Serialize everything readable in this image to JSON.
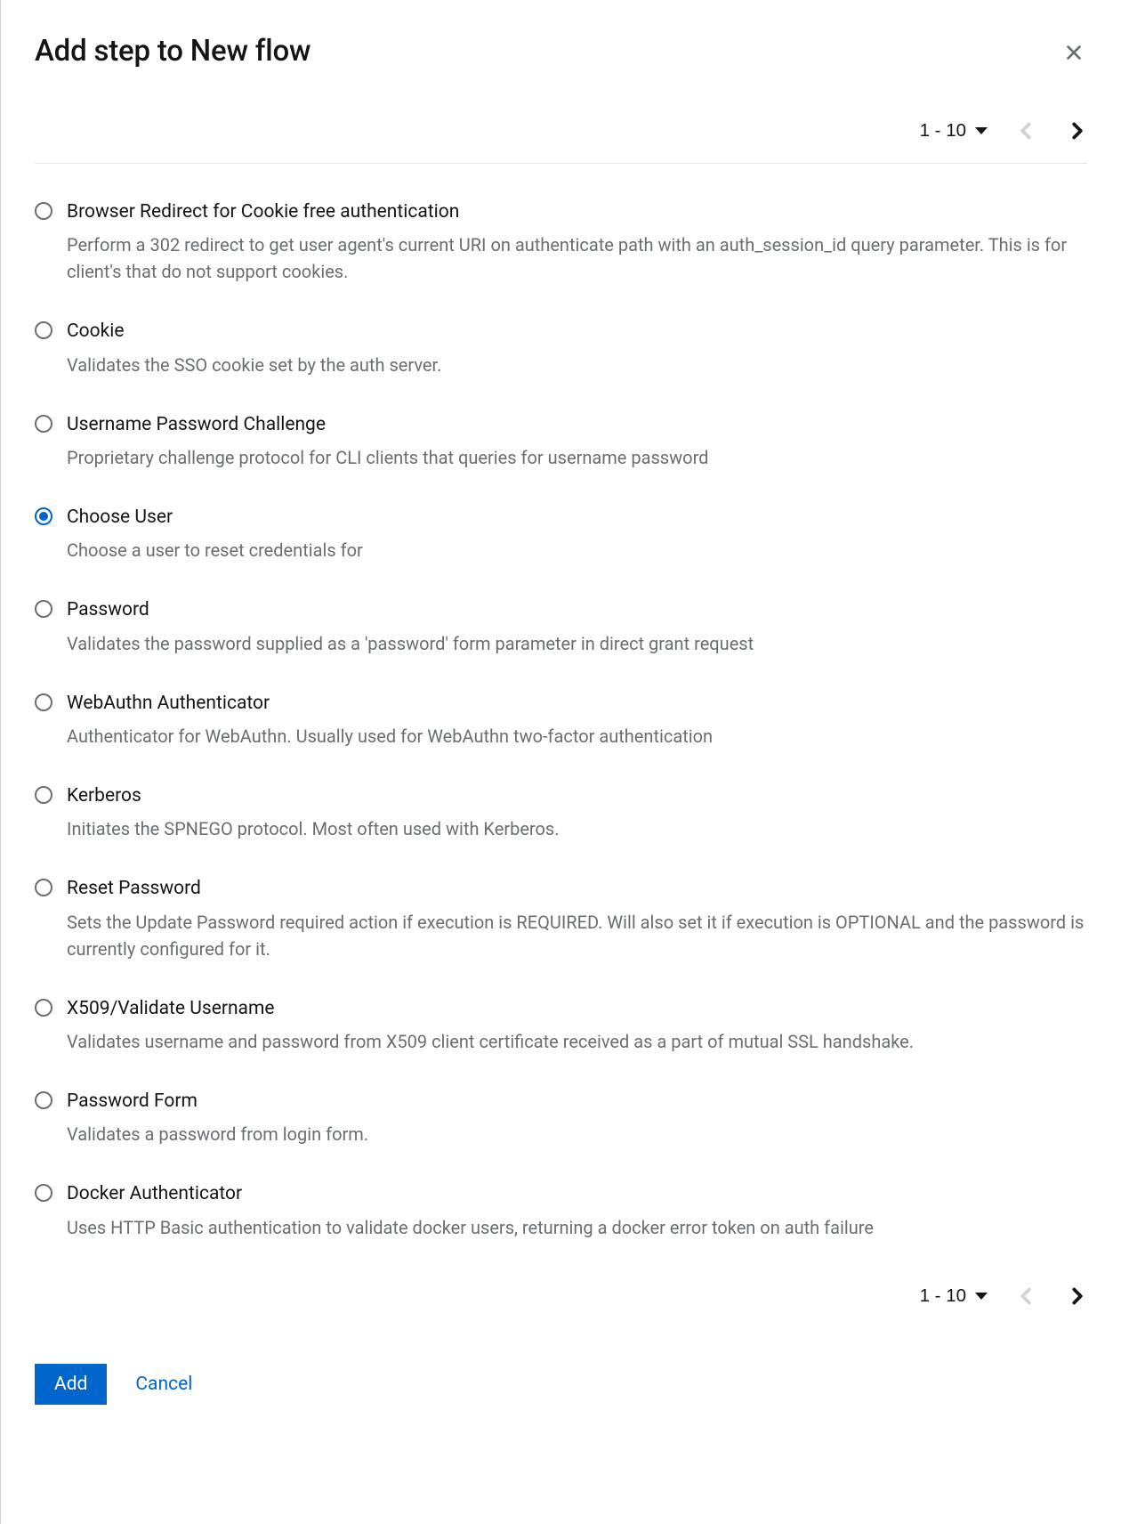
{
  "modal": {
    "title": "Add step to New flow",
    "pagination": {
      "label": "1 - 10"
    },
    "options": [
      {
        "title": "Browser Redirect for Cookie free authentication",
        "desc": "Perform a 302 redirect to get user agent's current URI on authenticate path with an auth_session_id query parameter. This is for client's that do not support cookies.",
        "selected": false
      },
      {
        "title": "Cookie",
        "desc": "Validates the SSO cookie set by the auth server.",
        "selected": false
      },
      {
        "title": "Username Password Challenge",
        "desc": "Proprietary challenge protocol for CLI clients that queries for username password",
        "selected": false
      },
      {
        "title": "Choose User",
        "desc": "Choose a user to reset credentials for",
        "selected": true
      },
      {
        "title": "Password",
        "desc": "Validates the password supplied as a 'password' form parameter in direct grant request",
        "selected": false
      },
      {
        "title": "WebAuthn Authenticator",
        "desc": "Authenticator for WebAuthn. Usually used for WebAuthn two-factor authentication",
        "selected": false
      },
      {
        "title": "Kerberos",
        "desc": "Initiates the SPNEGO protocol. Most often used with Kerberos.",
        "selected": false
      },
      {
        "title": "Reset Password",
        "desc": "Sets the Update Password required action if execution is REQUIRED. Will also set it if execution is OPTIONAL and the password is currently configured for it.",
        "selected": false
      },
      {
        "title": "X509/Validate Username",
        "desc": "Validates username and password from X509 client certificate received as a part of mutual SSL handshake.",
        "selected": false
      },
      {
        "title": "Password Form",
        "desc": "Validates a password from login form.",
        "selected": false
      },
      {
        "title": "Docker Authenticator",
        "desc": "Uses HTTP Basic authentication to validate docker users, returning a docker error token on auth failure",
        "selected": false
      }
    ],
    "footer": {
      "add_label": "Add",
      "cancel_label": "Cancel"
    }
  }
}
